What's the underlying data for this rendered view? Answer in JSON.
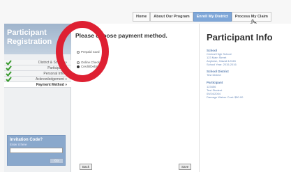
{
  "topnav": {
    "items": [
      "Home",
      "About Our Program",
      "Enroll My District",
      "Process My Claim"
    ],
    "active_index": 2
  },
  "sidebar": {
    "header_line1": "Participant",
    "header_line2": "Registration",
    "steps": [
      {
        "label": "District & School",
        "done": true
      },
      {
        "label": "Participant",
        "done": true
      },
      {
        "label": "Personal Info",
        "done": true
      },
      {
        "label": "Acknowledgement",
        "done": true
      },
      {
        "label": "Payment Method",
        "done": false
      }
    ],
    "step_suffix": " »",
    "invite": {
      "title": "Invitation Code?",
      "subtitle": "Enter it here",
      "field_value": "",
      "button_label": "Go"
    }
  },
  "main": {
    "heading": "Please choose payment method.",
    "options": [
      "Prepaid Card",
      "Online Check",
      "Credit/Debit Card"
    ],
    "selected_option": 2,
    "back_label": "Back",
    "save_label": "Save"
  },
  "info": {
    "title": "Participant Info",
    "school_heading": "School",
    "school_lines": [
      "Central High School",
      "123 Main Street",
      "Anytown, Hawaii 12345",
      "School Year: 2015-2016"
    ],
    "district_heading": "School District",
    "district_lines": [
      "Test District"
    ],
    "participant_heading": "Participant",
    "participant_lines": [
      "123456",
      "Test Student",
      "09/24/2004",
      "Damage Waiver Cost: $50.00"
    ]
  },
  "colors": {
    "annotation_circle": "#de2032",
    "active_nav": "#7fa7d8",
    "check_green": "#3a9a2e"
  },
  "icons": {
    "step_check": "check-icon",
    "cursor": "hand-cursor-icon"
  }
}
